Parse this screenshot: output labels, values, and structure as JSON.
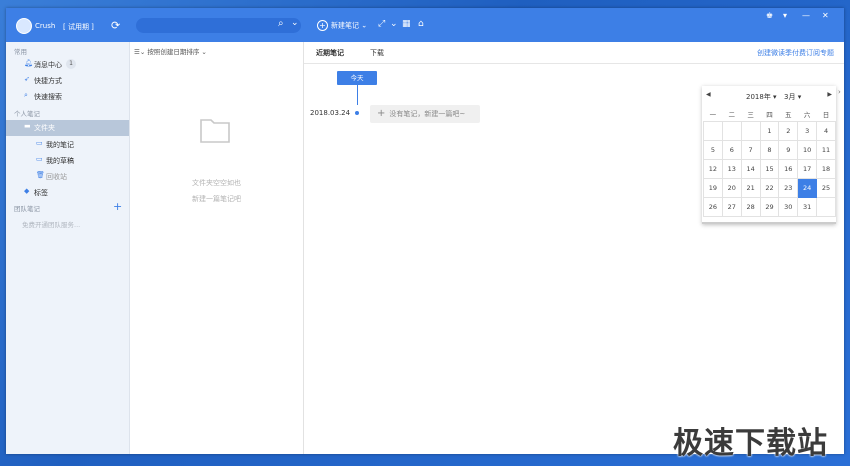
{
  "titlebar": {
    "username": "Crush",
    "trial": "[ 试用期 ]",
    "search_placeholder": "",
    "new_note": "新建笔记"
  },
  "sidebar": {
    "section_common": "常用",
    "messages": "消息中心",
    "messages_count": "1",
    "shortcuts": "快捷方式",
    "quick_search": "快速搜索",
    "section_personal": "个人笔记",
    "folder": "文件夹",
    "my_notes": "我的笔记",
    "my_drafts": "我的草稿",
    "recycle": "回收站",
    "tags": "标签",
    "section_team": "团队笔记",
    "team_hint": "免费开通团队服务..."
  },
  "listpane": {
    "sort_label": "按照创建日期排序",
    "empty_line1": "文件夹空空如也",
    "empty_line2": "新建一篇笔记吧"
  },
  "main": {
    "tab_recent": "近期笔记",
    "tab_download": "下载",
    "subscribe": "创建微读季付费订阅专题",
    "today": "今天",
    "date": "2018.03.24",
    "no_note": "没有笔记，新建一篇吧~"
  },
  "calendar": {
    "year": "2018年",
    "month": "3月",
    "weekdays": [
      "一",
      "二",
      "三",
      "四",
      "五",
      "六",
      "日"
    ],
    "weeks": [
      [
        "",
        "",
        "",
        "1",
        "2",
        "3",
        "4"
      ],
      [
        "5",
        "6",
        "7",
        "8",
        "9",
        "10",
        "11"
      ],
      [
        "12",
        "13",
        "14",
        "15",
        "16",
        "17",
        "18"
      ],
      [
        "19",
        "20",
        "21",
        "22",
        "23",
        "24",
        "25"
      ],
      [
        "26",
        "27",
        "28",
        "29",
        "30",
        "31",
        ""
      ]
    ],
    "selected": "24"
  },
  "watermark": "极速下载站",
  "colors": {
    "accent": "#3d7fe6",
    "sidebar_bg": "#eef3fa",
    "selected_bg": "#b8c7da"
  }
}
